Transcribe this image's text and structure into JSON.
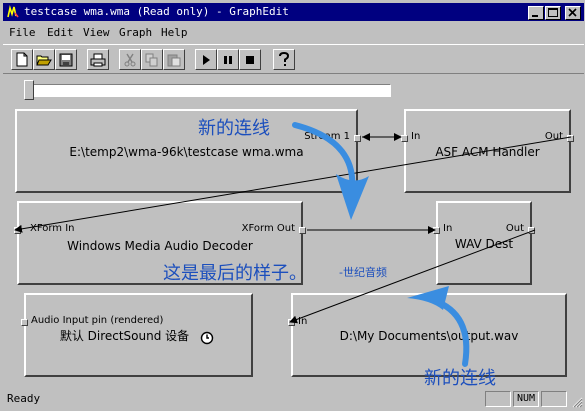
{
  "window": {
    "title": "testcase wma.wma (Read only) - GraphEdit",
    "controls": {
      "minimize": "_",
      "maximize": "□",
      "close": "×"
    }
  },
  "menu": [
    {
      "label": "File"
    },
    {
      "label": "Edit"
    },
    {
      "label": "View"
    },
    {
      "label": "Graph"
    },
    {
      "label": "Help"
    }
  ],
  "toolbar": {
    "buttons": [
      "new-icon",
      "open-icon",
      "save-icon",
      "print-icon",
      "cut-icon",
      "copy-icon",
      "paste-icon",
      "play-icon",
      "pause-icon",
      "stop-icon",
      "help-icon"
    ]
  },
  "seek": {
    "position": 0.0
  },
  "graph": {
    "filters": [
      {
        "id": "source",
        "name": "E:\\temp2\\wma-96k\\testcase wma.wma",
        "pins": [
          {
            "label": "Stream 1",
            "side": "out"
          }
        ]
      },
      {
        "id": "asf-acm",
        "name": "ASF ACM Handler",
        "pins": [
          {
            "label": "In",
            "side": "in"
          },
          {
            "label": "Out",
            "side": "out"
          }
        ]
      },
      {
        "id": "wma-decoder",
        "name": "Windows Media Audio Decoder",
        "pins": [
          {
            "label": "XForm In",
            "side": "in"
          },
          {
            "label": "XForm Out",
            "side": "out"
          }
        ]
      },
      {
        "id": "wav-dest",
        "name": "WAV Dest",
        "pins": [
          {
            "label": "In",
            "side": "in"
          },
          {
            "label": "Out",
            "side": "out"
          }
        ]
      },
      {
        "id": "dsound",
        "name": "默认 DirectSound 设备",
        "pins": [
          {
            "label": "Audio Input pin (rendered)",
            "side": "in"
          }
        ]
      },
      {
        "id": "file-writer",
        "name": "D:\\My Documents\\output.wav",
        "pins": [
          {
            "label": "In",
            "side": "in"
          }
        ]
      }
    ]
  },
  "annotations": {
    "new_connection_top": "新的连线",
    "final_look": "这是最后的样子。",
    "signature": "-世纪音频",
    "new_connection_bottom": "新的连线",
    "color": "#1c4fbd"
  },
  "status": {
    "text": "Ready",
    "num": "NUM"
  }
}
